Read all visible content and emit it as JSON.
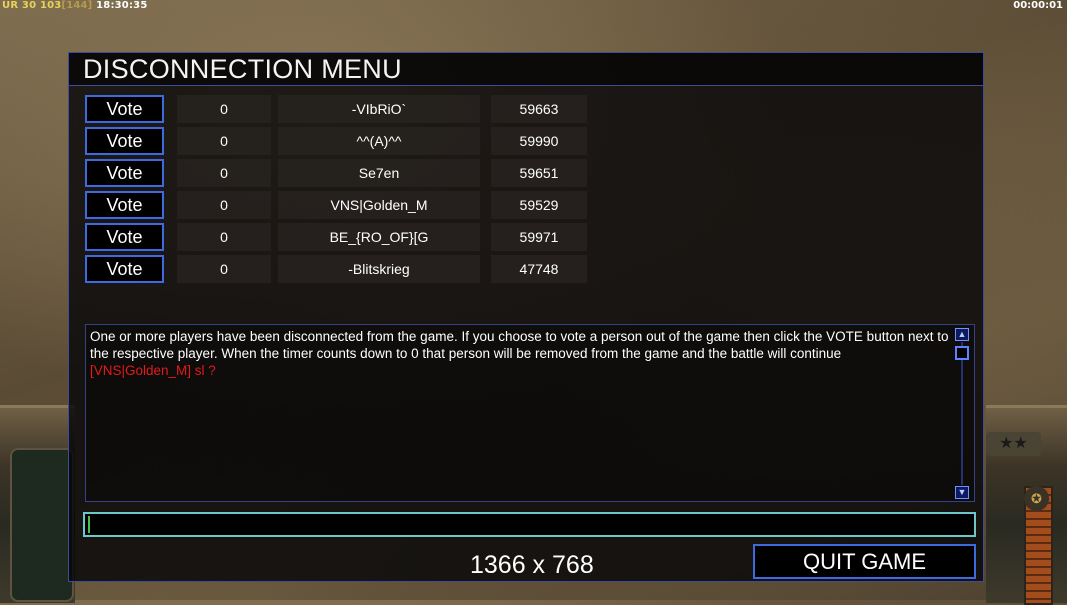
{
  "hud": {
    "ur_label": "UR",
    "ur_value": "30",
    "score": "103",
    "ping": "[144]",
    "clock": "18:30:35",
    "timer": "00:00:01"
  },
  "dialog": {
    "title": "DISCONNECTION MENU",
    "vote_label": "Vote",
    "players": [
      {
        "count": "0",
        "name": "-VIbRiO`",
        "id": "59663"
      },
      {
        "count": "0",
        "name": "^^(A)^^",
        "id": "59990"
      },
      {
        "count": "0",
        "name": "Se7en",
        "id": "59651"
      },
      {
        "count": "0",
        "name": "VNS|Golden_M",
        "id": "59529"
      },
      {
        "count": "0",
        "name": "BE_{RO_OF}[G",
        "id": "59971"
      },
      {
        "count": "0",
        "name": "-Blitskrieg",
        "id": "47748"
      }
    ],
    "message": "One or more players have been disconnected from the game. If you choose to vote a person out of the game then click the VOTE button next to the respective player. When the timer counts down to 0 that person will be removed from the game and the battle will continue",
    "chat_line": "[VNS|Golden_M] sl ?",
    "chat_input_value": "",
    "resolution": "1366 x 768",
    "quit_label": "QUIT GAME"
  },
  "icons": {
    "scroll_up": "arrow-up-icon",
    "scroll_down": "arrow-down-icon"
  },
  "colors": {
    "accent_blue": "#3e6ae0",
    "chat_red": "#e21a1a",
    "input_border": "#6cc7ca"
  }
}
